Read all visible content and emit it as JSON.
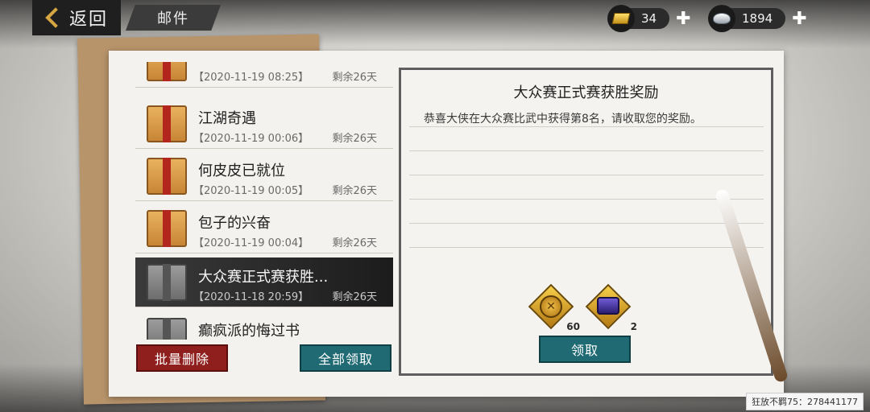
{
  "top_bar": {
    "back_label": "返回",
    "title": "邮件"
  },
  "currency": {
    "gold": {
      "icon": "gold-bar-icon",
      "value": "34"
    },
    "silver": {
      "icon": "silver-ingot-icon",
      "value": "1894"
    }
  },
  "mail_list": [
    {
      "title": "",
      "date": "【2020-11-19 08:25】",
      "remaining": "剩余26天",
      "selected": false
    },
    {
      "title": "江湖奇遇",
      "date": "【2020-11-19 00:06】",
      "remaining": "剩余26天",
      "selected": false
    },
    {
      "title": "何皮皮已就位",
      "date": "【2020-11-19 00:05】",
      "remaining": "剩余26天",
      "selected": false
    },
    {
      "title": "包子的兴奋",
      "date": "【2020-11-19 00:04】",
      "remaining": "剩余26天",
      "selected": false
    },
    {
      "title": "大众赛正式赛获胜...",
      "date": "【2020-11-18 20:59】",
      "remaining": "剩余26天",
      "selected": true
    },
    {
      "title": "癫疯派的悔过书",
      "date": "",
      "remaining": "",
      "selected": false
    }
  ],
  "buttons": {
    "batch_delete": "批量删除",
    "claim_all": "全部领取",
    "claim": "领取"
  },
  "detail": {
    "title": "大众赛正式赛获胜奖励",
    "body": "恭喜大侠在大众赛比武中获得第8名，请收取您的奖励。",
    "rewards": [
      {
        "icon": "copper-coin-icon",
        "count": "60"
      },
      {
        "icon": "treasure-chest-icon",
        "count": "2"
      }
    ]
  },
  "watermark": "狂放不羁75：278441177",
  "colors": {
    "gold_accent": "#d6a642",
    "delete_red": "#8e1f1d",
    "teal_button": "#1f6a73"
  }
}
